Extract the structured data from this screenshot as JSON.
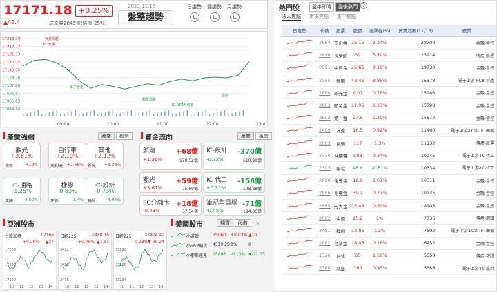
{
  "header": {
    "index": "17171.18",
    "change_pct": "+0.25%",
    "change_pts": "▲42.4",
    "volume": "成交量2845億(估值-25%)",
    "date": "2023.11.16",
    "trend_button": "盤整趨勢",
    "periods": [
      "日趨勢",
      "週趨勢",
      "月趨勢"
    ]
  },
  "chart_data": {
    "type": "line",
    "y_ticks": [
      "17233.70",
      "17212.72",
      "17191.73",
      "17170.75",
      "17149.76",
      "17128.78",
      "17107.80",
      "17086.81",
      "17065.83",
      "17044.84"
    ],
    "x_ticks": [
      "09:00",
      "10:00",
      "11:00",
      "12:00",
      "13:00"
    ],
    "ylim": [
      17044.84,
      17233.7
    ],
    "annotations": [
      "外資買超",
      "PC大漲",
      "電子股走",
      "箱型弱勢",
      "IC-DRAM強勢",
      "強勢"
    ],
    "series": [
      {
        "x": [
          0,
          0.05,
          0.1,
          0.15,
          0.2,
          0.25,
          0.3,
          0.35,
          0.4,
          0.45,
          0.5,
          0.55,
          0.6,
          0.65,
          0.7,
          0.75,
          0.8,
          0.85,
          0.9,
          0.95,
          1
        ],
        "y": [
          17160,
          17175,
          17178,
          17168,
          17150,
          17120,
          17100,
          17110,
          17105,
          17098,
          17105,
          17112,
          17108,
          17118,
          17125,
          17120,
          17128,
          17130,
          17128,
          17135,
          17171
        ]
      }
    ],
    "volume_note": "volume bars"
  },
  "industry": {
    "title": "產業強弱",
    "tabs": [
      "產業",
      "概念"
    ],
    "cards": [
      {
        "name": "觀光",
        "pct": "+3.61%",
        "sub": "流新",
        "subv": "+10%",
        "dir": "up"
      },
      {
        "name": "自行車",
        "pct": "+2.19%",
        "sub": "美利達",
        "subv": "+2.68%",
        "dir": "up"
      },
      {
        "name": "其他",
        "pct": "+2.12%",
        "sub": "新光",
        "subv": "+3.28%",
        "dir": "up"
      },
      {
        "name": "IC-通路",
        "pct": "-1.25%",
        "sub": "文曄",
        "subv": "-4.82%",
        "dir": "down"
      },
      {
        "name": "橡膠",
        "pct": "-0.83%",
        "sub": "正新",
        "subv": "-1.4%",
        "dir": "down"
      },
      {
        "name": "IC-設計",
        "pct": "-0.73%",
        "sub": "聯詠",
        "subv": "-4.04%",
        "dir": "down"
      }
    ]
  },
  "fund": {
    "title": "資金流向",
    "tabs": [
      "產業",
      "概念"
    ],
    "cards": [
      {
        "name": "航運",
        "big": "+68億",
        "pct": "+1.36%",
        "amt": "170.52億",
        "dir": "up"
      },
      {
        "name": "IC-設計",
        "big": "-370億",
        "pct": "-0.73%",
        "amt": "610.98億",
        "dir": "down"
      },
      {
        "name": "觀光",
        "big": "+59億",
        "pct": "+3.61%",
        "amt": "75.69億",
        "dir": "up"
      },
      {
        "name": "IC-代工",
        "big": "-156億",
        "pct": "+0.31%",
        "amt": "198.88億",
        "dir": "down"
      },
      {
        "name": "PC介面卡",
        "big": "+18億",
        "pct": "-0.43%",
        "amt": "37.34億",
        "dir": "up"
      },
      {
        "name": "筆記型電腦",
        "big": "-71億",
        "pct": "-0.45%",
        "amt": "184.06億",
        "dir": "down"
      }
    ]
  },
  "asia": {
    "title": "亞洲股市",
    "markets": [
      {
        "name": "台股加權",
        "price": "17166",
        "pct": "+0.26%",
        "chg": "▲37",
        "ticks": [
          "17208",
          "17158",
          "17109"
        ]
      },
      {
        "name": "日經225",
        "price": "2488.16",
        "pct": "+0.06%",
        "chg": "▲1.51",
        "ticks": [
          "3492",
          "2488",
          "2475"
        ]
      },
      {
        "name": "日經225",
        "price": "33424.41",
        "pct": "-0.28%",
        "chg": "▼-95.24",
        "ticks": [
          "33636",
          "33520",
          "33234"
        ]
      }
    ],
    "x_ticks": [
      "10",
      "11",
      "12",
      "13",
      "14"
    ]
  },
  "us": {
    "title": "美國股市",
    "tabs": [
      "期貨",
      "股數"
    ],
    "date": "日期 11/16",
    "rows": [
      {
        "name": "小道瓊",
        "value": "35060",
        "pct": "+0.03%",
        "chg": "▲10"
      },
      {
        "name": "小S&P期貨",
        "value": "4519.25",
        "pct": "0%",
        "chg": "0"
      },
      {
        "name": "小那斯達克",
        "value": "15868",
        "pct": "-0.13%",
        "chg": "▼-21.25"
      }
    ]
  },
  "hot": {
    "title": "熱門股",
    "tabs": [
      "盤中即時",
      "盤後熱門"
    ],
    "sub_tabs": [
      "法人焦點",
      "市場焦點",
      "集中焦點"
    ],
    "columns": [
      "日走勢",
      "代號",
      "股票",
      "股價",
      "漲跌幅(%)",
      "買賣超數(11/16)",
      "產業"
    ],
    "rows": [
      {
        "code": "2884",
        "name": "玉山金",
        "price": "25.15",
        "pct": "2.24%",
        "vol": "28700",
        "ind": "金融-金控"
      },
      {
        "code": "2618",
        "name": "長榮航",
        "price": "32",
        "pct": "5.79%",
        "vol": "25914",
        "ind": "傳產-航運"
      },
      {
        "code": "2891",
        "name": "中信金",
        "price": "26.85",
        "pct": "0.19%",
        "vol": "19730",
        "ind": "金融-金控"
      },
      {
        "code": "2355",
        "name": "敬鵬",
        "price": "42.45",
        "pct": "8.85%",
        "vol": "16378",
        "ind": "電子上游-PCB-製造"
      },
      {
        "code": "2888",
        "name": "新光金",
        "price": "9.07",
        "pct": "0.78%",
        "vol": "15966",
        "ind": "金融-金控"
      },
      {
        "code": "2883",
        "name": "開發金",
        "price": "11.95",
        "pct": "1.27%",
        "vol": "15798",
        "ind": "金融-金控"
      },
      {
        "code": "2892",
        "name": "第一金",
        "price": "27.5",
        "pct": "1.29%",
        "vol": "15672",
        "ind": "金融-金控"
      },
      {
        "code": "2409",
        "name": "友達",
        "price": "16.5",
        "pct": "0.92%",
        "vol": "11460",
        "ind": "電子中游-LCD-TFT面板"
      },
      {
        "code": "2603",
        "name": "長榮",
        "price": "117",
        "pct": "1.3%",
        "vol": "11132",
        "ind": "傳產-航運"
      },
      {
        "code": "2330",
        "name": "台積電",
        "price": "583",
        "pct": "0.34%",
        "vol": "10945",
        "ind": "電子上游-IC-代工"
      },
      {
        "code": "2303",
        "name": "聯電",
        "price": "48.8",
        "pct": "-0.61%",
        "vol": "10334",
        "ind": "電子上游-IC-代工"
      },
      {
        "code": "2890",
        "name": "永豐金",
        "price": "18.9",
        "pct": "1.07%",
        "vol": "10311",
        "ind": "金融-金控"
      },
      {
        "code": "2886",
        "name": "兆豐金",
        "price": "39.2",
        "pct": "0.77%",
        "vol": "10135",
        "ind": "金融-金控"
      },
      {
        "code": "2885",
        "name": "元大金",
        "price": "25.45",
        "pct": "0.59%",
        "vol": "8903",
        "ind": "金融-金控"
      },
      {
        "code": "2002",
        "name": "中鋼",
        "price": "25.2",
        "pct": "1%",
        "vol": "7736",
        "ind": "傳產-鋼鐵"
      },
      {
        "code": "3481",
        "name": "群創",
        "price": "12.85",
        "pct": "1.2%",
        "vol": "7692",
        "ind": "電子中游-LCD-TFT面板"
      },
      {
        "code": "2887",
        "name": "台新金",
        "price": "18.05",
        "pct": "0.28%",
        "vol": "6252",
        "ind": "金融-金控"
      },
      {
        "code": "1326",
        "name": "台化",
        "price": "65",
        "pct": "1.56%",
        "vol": "5550",
        "ind": "傳產-塑膠"
      },
      {
        "code": "2388",
        "name": "威盛",
        "price": "160",
        "pct": "0.95%",
        "vol": "5386",
        "ind": "電子上游-IC-設計"
      }
    ]
  },
  "colors": {
    "up": "#e02020",
    "down": "#1a9a4a"
  }
}
